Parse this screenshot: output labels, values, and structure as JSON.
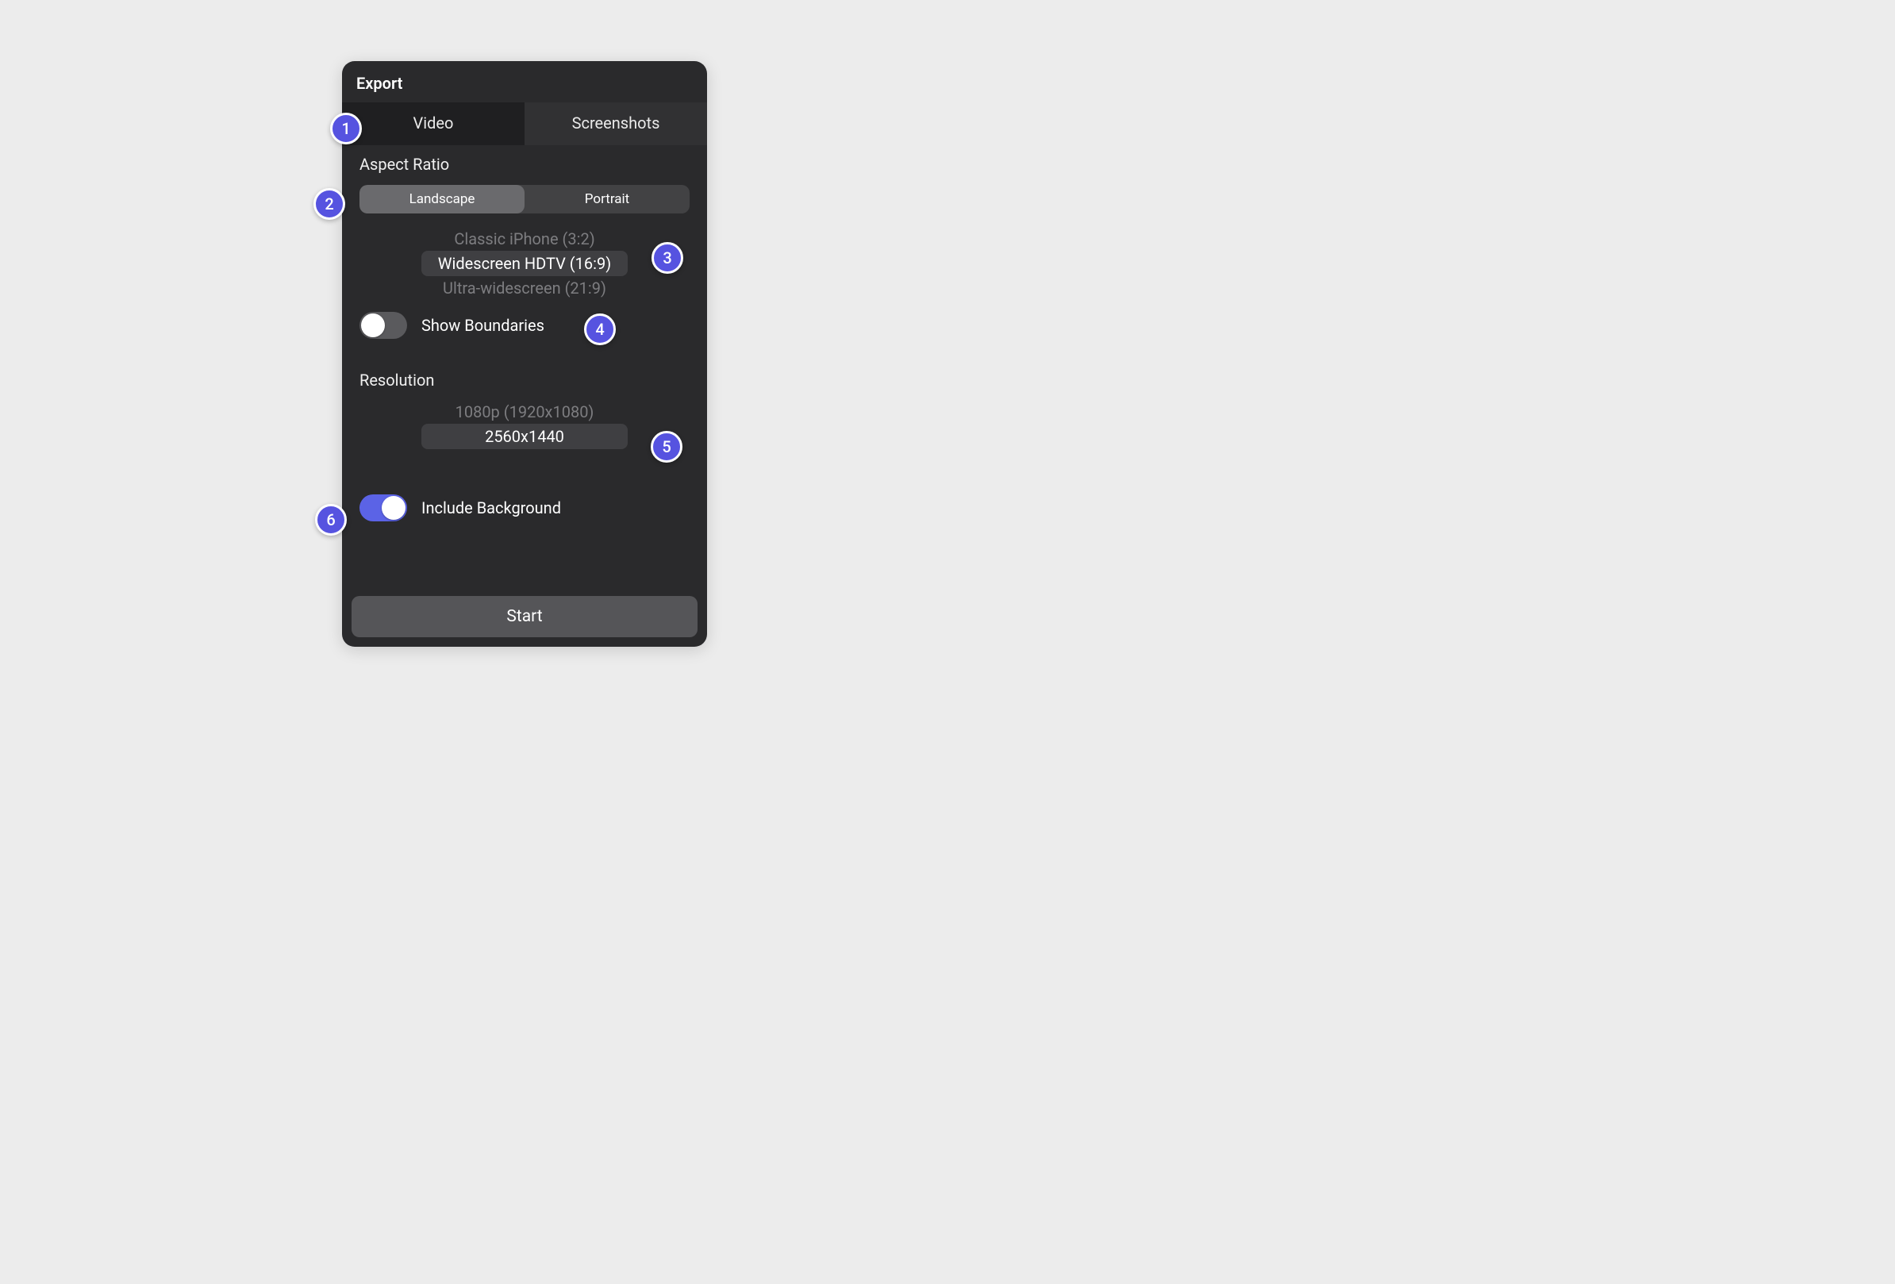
{
  "panel": {
    "title": "Export",
    "tabs": {
      "video": "Video",
      "screenshots": "Screenshots",
      "active": "video"
    },
    "aspect": {
      "label": "Aspect Ratio",
      "seg": {
        "landscape": "Landscape",
        "portrait": "Portrait",
        "selected": "landscape"
      },
      "wheel": {
        "prev": "Classic iPhone (3:2)",
        "sel": "Widescreen HDTV (16:9)",
        "next": "Ultra-widescreen (21:9)"
      }
    },
    "boundaries": {
      "label": "Show Boundaries",
      "on": false
    },
    "resolution": {
      "label": "Resolution",
      "wheel": {
        "prev": "1080p (1920x1080)",
        "sel": "2560x1440"
      }
    },
    "background": {
      "label": "Include Background",
      "on": true
    },
    "start": "Start"
  },
  "badges": {
    "b1": "1",
    "b2": "2",
    "b3": "3",
    "b4": "4",
    "b5": "5",
    "b6": "6"
  },
  "colors": {
    "accent": "#5653e0"
  }
}
